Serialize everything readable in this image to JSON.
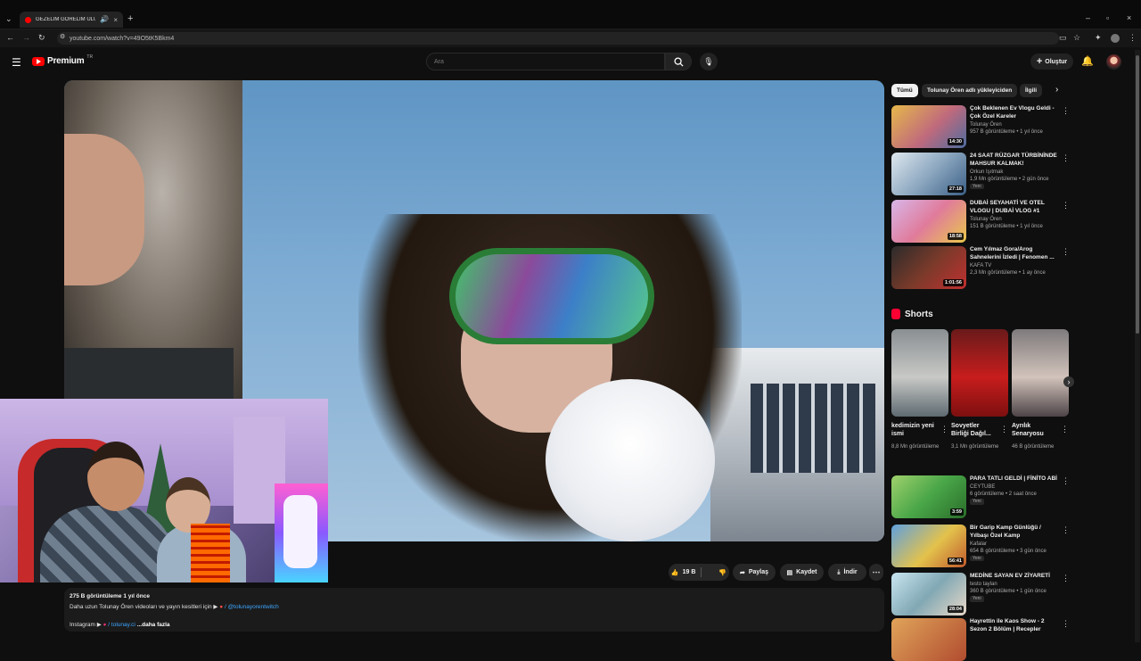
{
  "browser": {
    "tab_title": "GEZELİM GÖRELİM ULUDA...",
    "new_tab": "+",
    "url": "youtube.com/watch?v=49O5tK5Bkm4"
  },
  "header": {
    "brand": "Premium",
    "brand_suffix": "TR",
    "search_placeholder": "Ara",
    "create_label": "Oluştur"
  },
  "chips": [
    "Tümü",
    "Tolunay Ören adlı yükleyiciden",
    "İlgili"
  ],
  "recommendations": [
    {
      "title": "Çok Beklenen Ev Vlogu Geldi - Çok Özel Kareler",
      "channel": "Tolunay Ören",
      "views": "957 B görüntüleme • 1 yıl önce",
      "duration": "14:30",
      "badge": "",
      "thumb": "linear-gradient(135deg,#e6b84a,#c06a7c 55%,#4d6ca0)"
    },
    {
      "title": "24 SAAT RÜZGAR TÜRBİNİNDE MAHSUR KALMAK!",
      "channel": "Orkun Işıtmak",
      "views": "1,9 Mn görüntüleme • 2 gün önce",
      "duration": "27:18",
      "badge": "Yeni",
      "thumb": "linear-gradient(135deg,#dfe8ef,#8da8c0 50%,#3b5f86)"
    },
    {
      "title": "DUBAİ SEYAHATİ VE OTEL VLOGU | DUBAİ VLOG #1",
      "channel": "Tolunay Ören",
      "views": "151 B görüntüleme • 1 yıl önce",
      "duration": "18:58",
      "badge": "",
      "thumb": "linear-gradient(135deg,#d7b6e8,#e07b9b 50%,#e9c84b)"
    },
    {
      "title": "Cem Yılmaz Gora/Arog Sahnelerini İzledi | Fenomen ...",
      "channel": "KAFA TV",
      "views": "2,3 Mn görüntüleme • 1 ay önce",
      "duration": "1:01:56",
      "badge": "",
      "thumb": "linear-gradient(135deg,#2b2b2b,#7a3a2a 50%,#c13030)"
    }
  ],
  "shorts": {
    "heading": "Shorts",
    "items": [
      {
        "title": "kedimizin yeni ismi",
        "views": "8,8 Mn görüntüleme",
        "thumb": "linear-gradient(180deg,#8a8f93,#c8c9c6 55%,#5e6a71)"
      },
      {
        "title": "Sovyetler Birliği Dağıl...",
        "views": "3,1 Mn görüntüleme",
        "thumb": "linear-gradient(180deg,#6a1a1a,#c81d1d 55%,#7d0f0f)"
      },
      {
        "title": "Ayrılık Senaryosu",
        "views": "46 B görüntüleme",
        "thumb": "linear-gradient(180deg,#7e7a7c,#d2c3bb 55%,#4d4447)"
      }
    ]
  },
  "recommendations_more": [
    {
      "title": "PARA TATLI GELDİ | FİNİTO ABİ",
      "channel": "CEYTUBE",
      "views": "6 görüntüleme • 2 saat önce",
      "duration": "3:59",
      "badge": "Yeni",
      "thumb": "linear-gradient(135deg,#9fd16c,#49a648 50%,#2a6d2a)"
    },
    {
      "title": "Bir Garip Kamp Günlüğü / Yılbaşı Özel Kamp",
      "channel": "Kafalar",
      "views": "654 B görüntüleme • 3 gün önce",
      "duration": "56:41",
      "badge": "Yeni",
      "thumb": "linear-gradient(135deg,#5fa0de,#e3c24c 55%,#c05a2c)"
    },
    {
      "title": "MEDİNE SAYAN EV ZİYARETİ",
      "channel": "testo taylan",
      "views": "360 B görüntüleme • 1 gün önce",
      "duration": "28:04",
      "badge": "Yeni",
      "thumb": "linear-gradient(135deg,#c9e6f1,#81a8b4 50%,#e9d9c9)"
    },
    {
      "title": "Hayrettin ile Kaos Show - 2 Sezon 2 Bölüm | Recepler",
      "channel": "",
      "views": "",
      "duration": "",
      "badge": "",
      "thumb": "linear-gradient(135deg,#e0a45a,#b14c2f)"
    }
  ],
  "actions": {
    "likes": "19 B",
    "share": "Paylaş",
    "save": "Kaydet",
    "download": "İndir"
  },
  "description": {
    "stats": "275 B görüntüleme  1 yıl önce",
    "line1": "Daha uzun Tolunay Ören videoları ve yayın kesitleri için ▶",
    "line1_handle": "/ @tolunayorentwitch",
    "line2_prefix": "Instagram ▶",
    "line2_handle": "/ tolunay.ci",
    "more": "...daha fazla"
  },
  "colors": {
    "accent": "#ff0000",
    "bg": "#0f0f0f"
  }
}
